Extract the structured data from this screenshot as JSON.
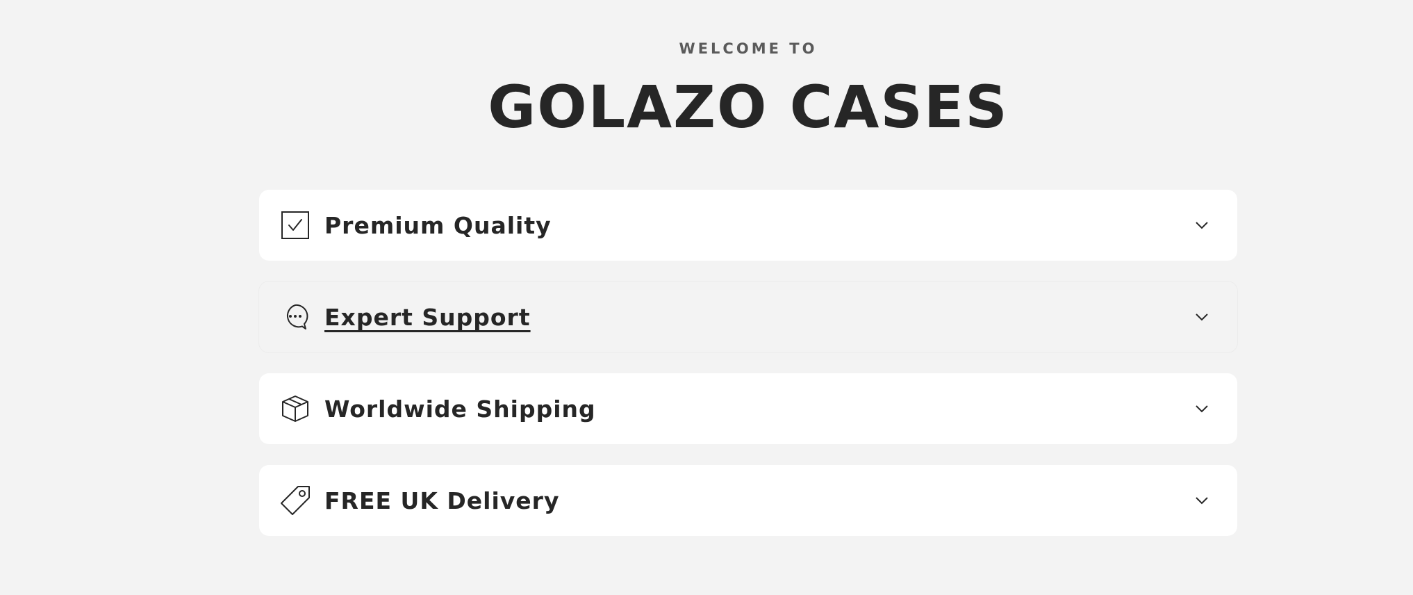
{
  "header": {
    "eyebrow": "WELCOME TO",
    "title": "GOLAZO CASES"
  },
  "accordion": {
    "items": [
      {
        "label": "Premium Quality",
        "icon": "checkbox-check-icon"
      },
      {
        "label": "Expert Support",
        "icon": "chat-bubble-icon"
      },
      {
        "label": "Worldwide Shipping",
        "icon": "package-box-icon"
      },
      {
        "label": "FREE UK Delivery",
        "icon": "price-tag-icon"
      }
    ]
  },
  "colors": {
    "background": "#f3f3f3",
    "card": "#ffffff",
    "text": "#262626",
    "eyebrow": "#5a5a5a"
  }
}
